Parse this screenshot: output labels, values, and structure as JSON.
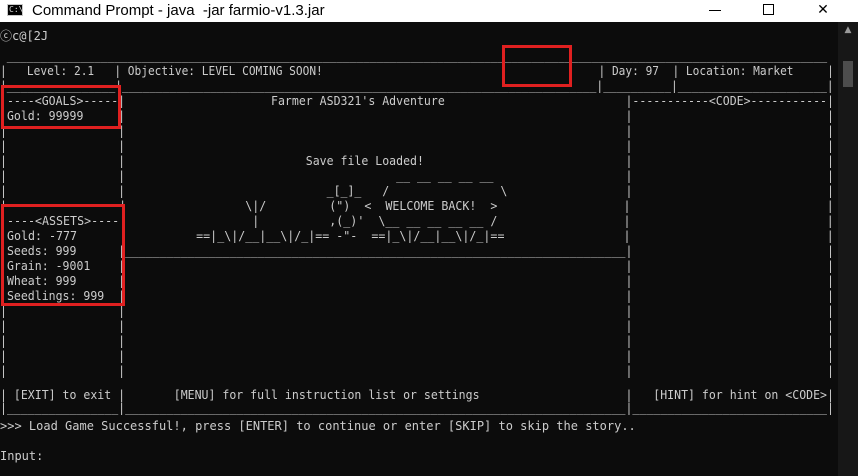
{
  "window": {
    "title": "Command Prompt - java  -jar farmio-v1.3.jar",
    "icon_label": "C:\\",
    "minimize_label": "",
    "maximize_label": "",
    "close_label": "✕",
    "scroll_up_label": "▲"
  },
  "terminal": {
    "lines": [
      "ⓒc@[2J",
      " __________________________________________________________________________________________________________________________ ",
      "|   Level: 2.1   | Objective: LEVEL COMING SOON!                                         | Day: 97  | Location: Market     |",
      "|________________|______________________________________________________________________|__________|______________________|",
      "|----<GOALS>-----|                     Farmer ASD321's Adventure                          |-----------<CODE>-----------|",
      "|Gold: 99999     |                                                                        |                            |",
      "|                |                                                                        |                            |",
      "|                |                                                                        |                            |",
      "|                |                          Save file Loaded!                             |                            |",
      "|                |                                       __ __ __ __ __                   |                            |",
      "|                |                             _[_]_   /                \\                 |                            |",
      "|                |                 \\|/         (\")  <  WELCOME BACK!  >                  |                            |",
      "|----<ASSETS>----|                  |          ,(_)'  \\__ __ __ __ __ /                  |                            |",
      "|Gold: -777      |          ==|_\\|/__|__\\|/_|== -\"-  ==|_\\|/__|__\\|/_|==                 |                            |",
      "|Seeds: 999      |________________________________________________________________________|                            |",
      "|Grain: -9001    |                                                                        |                            |",
      "|Wheat: 999      |                                                                        |                            |",
      "|Seedlings: 999  |                                                                        |                            |",
      "|                |                                                                        |                            |",
      "|                |                                                                        |                            |",
      "|                |                                                                        |                            |",
      "|                |                                                                        |                            |",
      "|                |                                                                        |                            |",
      "| [EXIT] to exit |       [MENU] for full instruction list or settings                     |   [HINT] for hint on <CODE>|",
      "|________________|________________________________________________________________________|____________________________|",
      "",
      ">>> Load Game Successful!, press [ENTER] to continue or enter [SKIP] to skip the story..",
      "",
      "",
      "Input:"
    ]
  }
}
